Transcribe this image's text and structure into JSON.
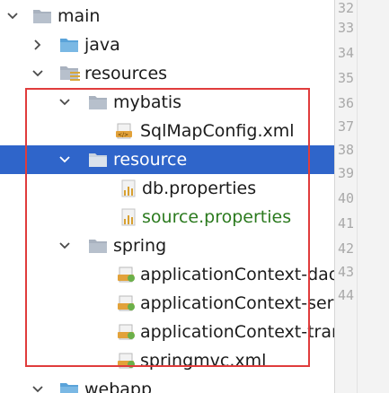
{
  "tree": {
    "rows": [
      {
        "id": "main",
        "label": "main",
        "arrow": "down",
        "icon": "folder"
      },
      {
        "id": "java",
        "label": "java",
        "arrow": "right",
        "icon": "source-folder"
      },
      {
        "id": "resources",
        "label": "resources",
        "arrow": "down",
        "icon": "resources-folder"
      },
      {
        "id": "mybatis",
        "label": "mybatis",
        "arrow": "down",
        "icon": "folder"
      },
      {
        "id": "sqlmapconfig",
        "label": "SqlMapConfig.xml",
        "arrow": "",
        "icon": "xml-file"
      },
      {
        "id": "resource",
        "label": "resource",
        "arrow": "down",
        "icon": "folder",
        "selected": true
      },
      {
        "id": "db-properties",
        "label": "db.properties",
        "arrow": "",
        "icon": "properties-file"
      },
      {
        "id": "source-properties",
        "label": "source.properties",
        "arrow": "",
        "icon": "properties-file",
        "status": "new"
      },
      {
        "id": "spring",
        "label": "spring",
        "arrow": "down",
        "icon": "folder"
      },
      {
        "id": "appctx-dao",
        "label": "applicationContext-dao.x",
        "arrow": "",
        "icon": "xml-file"
      },
      {
        "id": "appctx-service",
        "label": "applicationContext-servi",
        "arrow": "",
        "icon": "xml-file"
      },
      {
        "id": "appctx-trans",
        "label": "applicationContext-trans",
        "arrow": "",
        "icon": "xml-file"
      },
      {
        "id": "springmvc",
        "label": "springmvc.xml",
        "arrow": "",
        "icon": "xml-file"
      },
      {
        "id": "webapp",
        "label": "webapp",
        "arrow": "down",
        "icon": "folder"
      }
    ]
  },
  "gutter": {
    "line_numbers": [
      "32",
      "33",
      "34",
      "35",
      "36",
      "37",
      "38",
      "39",
      "40",
      "41",
      "42",
      "43",
      "44"
    ]
  },
  "colors": {
    "selection": "#2f65ca",
    "highlight_box": "#e03c3c",
    "new_file_text": "#2b7a1e"
  }
}
